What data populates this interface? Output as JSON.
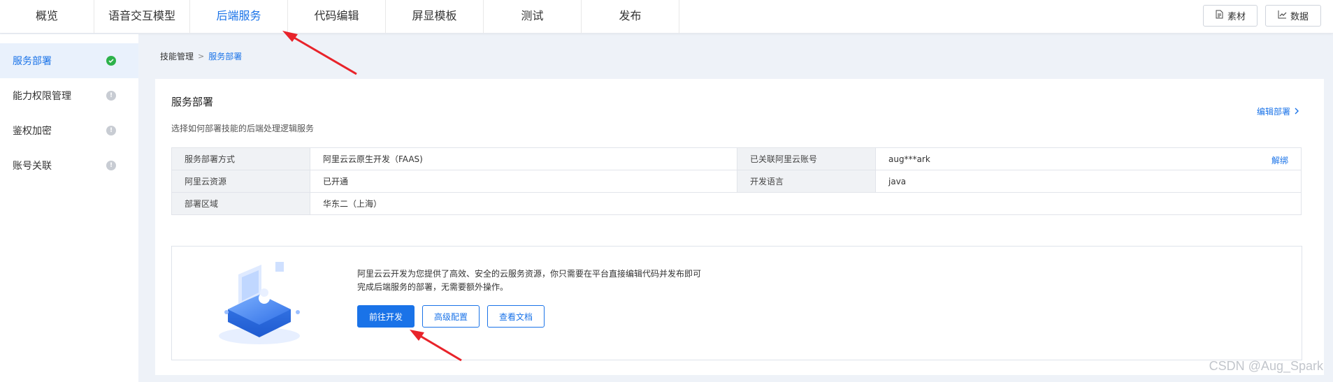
{
  "top_nav": {
    "tabs": [
      {
        "label": "概览"
      },
      {
        "label": "语音交互模型"
      },
      {
        "label": "后端服务"
      },
      {
        "label": "代码编辑"
      },
      {
        "label": "屏显模板"
      },
      {
        "label": "测试"
      },
      {
        "label": "发布"
      }
    ],
    "active_tab": "后端服务",
    "right_buttons": [
      {
        "label": "素材",
        "icon": "file-icon"
      },
      {
        "label": "数据",
        "icon": "line-chart-icon"
      }
    ]
  },
  "sidebar": {
    "items": [
      {
        "label": "服务部署",
        "status": "complete"
      },
      {
        "label": "能力权限管理",
        "status": "pending"
      },
      {
        "label": "鉴权加密",
        "status": "pending"
      },
      {
        "label": "账号关联",
        "status": "pending"
      }
    ]
  },
  "breadcrumb": {
    "parent": "技能管理",
    "current": "服务部署"
  },
  "card": {
    "title": "服务部署",
    "subtitle": "选择如何部署技能的后端处理逻辑服务",
    "edit_link": "编辑部署",
    "info": {
      "deploy_method_key": "服务部署方式",
      "deploy_method_value": "阿里云云原生开发（FAAS)",
      "linked_account_key": "已关联阿里云账号",
      "linked_account_value": "aug***ark",
      "unbind_link": "解绑",
      "resource_key": "阿里云资源",
      "resource_value": "已开通",
      "language_key": "开发语言",
      "language_value": "java",
      "region_key": "部署区域",
      "region_value": "华东二（上海）"
    },
    "promo": {
      "text": "阿里云云开发为您提供了高效、安全的云服务资源，你只需要在平台直接编辑代码并发布即可完成后端服务的部署，无需要额外操作。",
      "buttons": {
        "develop": "前往开发",
        "advanced": "高级配置",
        "docs": "查看文档"
      }
    }
  },
  "watermark": "CSDN @Aug_Spark",
  "colors": {
    "accent": "#1a73e8",
    "success": "#2db24a",
    "annotation_arrow": "#e8232a"
  }
}
